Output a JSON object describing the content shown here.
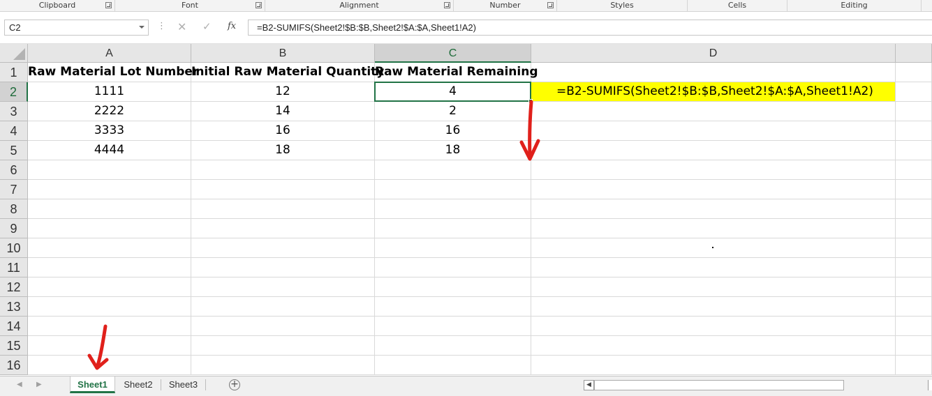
{
  "ribbon": {
    "groups": [
      "Clipboard",
      "Font",
      "Alignment",
      "Number",
      "Styles",
      "Cells",
      "Editing"
    ]
  },
  "formula_bar": {
    "name_box": "C2",
    "fx_label": "fx",
    "formula": "=B2-SUMIFS(Sheet2!$B:$B,Sheet2!$A:$A,Sheet1!A2)"
  },
  "grid": {
    "columns": [
      "A",
      "B",
      "C",
      "D"
    ],
    "rows": [
      "1",
      "2",
      "3",
      "4",
      "5",
      "6",
      "7",
      "8",
      "9",
      "10",
      "11",
      "12",
      "13",
      "14",
      "15",
      "16"
    ],
    "headers": {
      "A": "Raw Material Lot Number",
      "B": "Initial Raw Material Quantity",
      "C": "Raw Material Remaining"
    },
    "data": [
      {
        "A": "1111",
        "B": "12",
        "C": "4"
      },
      {
        "A": "2222",
        "B": "14",
        "C": "2"
      },
      {
        "A": "3333",
        "B": "16",
        "C": "16"
      },
      {
        "A": "4444",
        "B": "18",
        "C": "18"
      }
    ],
    "d2_text": "=B2-SUMIFS(Sheet2!$B:$B,Sheet2!$A:$A,Sheet1!A2)",
    "active_cell": "C2",
    "highlight_color": "#ffff00",
    "accent_color": "#217346"
  },
  "sheets": {
    "tabs": [
      "Sheet1",
      "Sheet2",
      "Sheet3"
    ],
    "active": "Sheet1",
    "add_icon": "plus-circle-icon"
  },
  "annotations": {
    "arrow_color": "#e0201b"
  }
}
